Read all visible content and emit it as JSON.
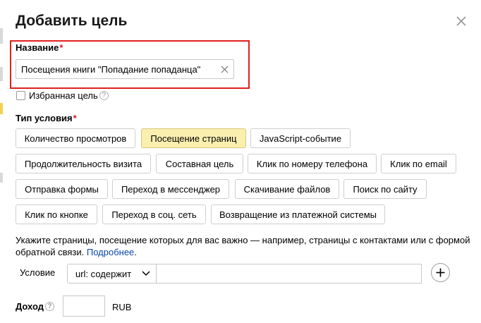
{
  "dialog": {
    "title": "Добавить цель",
    "close_icon": "close-icon"
  },
  "name_field": {
    "label": "Название",
    "required_mark": "*",
    "value": "Посещения книги \"Попадание попаданца\"",
    "clear_icon": "clear-icon"
  },
  "favorite": {
    "label": "Избранная цель",
    "help": "?",
    "checked": false
  },
  "condition_type": {
    "label": "Тип условия",
    "required_mark": "*",
    "options": [
      "Количество просмотров",
      "Посещение страниц",
      "JavaScript-событие",
      "Продолжительность визита",
      "Составная цель",
      "Клик по номеру телефона",
      "Клик по email",
      "Отправка формы",
      "Переход в мессенджер",
      "Скачивание файлов",
      "Поиск по сайту",
      "Клик по кнопке",
      "Переход в соц. сеть",
      "Возвращение из платежной системы"
    ],
    "selected": "Посещение страниц"
  },
  "info": {
    "text": "Укажите страницы, посещение которых для вас важно — например, страницы с контактами или с формой обратной связи.",
    "link": "Подробнее",
    "end": "."
  },
  "condition": {
    "label": "Условие",
    "select_value": "url: содержит",
    "url_value": "",
    "add_icon": "plus-icon"
  },
  "income": {
    "label": "Доход",
    "help": "?",
    "value": "",
    "currency": "RUB"
  },
  "colors": {
    "accent_selected": "#fbefb0",
    "highlight": "#e0201d",
    "required": "#d8182f",
    "link": "#0a47ad"
  }
}
